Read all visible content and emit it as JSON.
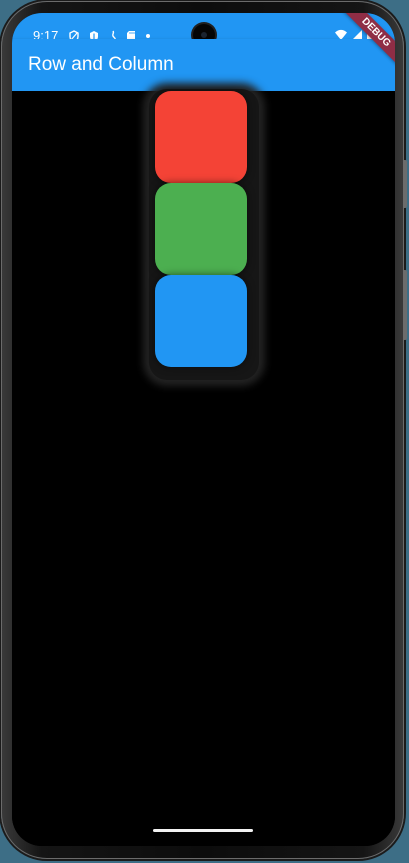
{
  "status_bar": {
    "time": "9:17",
    "background": "#2196f3",
    "left_icons": [
      "privacy-shield-icon",
      "security-shield-icon",
      "assistant-icon",
      "sd-card-icon",
      "notification-dot-icon"
    ],
    "right_icons": [
      "wifi-icon",
      "signal-icon",
      "battery-icon"
    ]
  },
  "app_bar": {
    "title": "Row and Column",
    "background": "#2196f3"
  },
  "debug_banner": {
    "label": "DEBUG",
    "color": "#8f2d45"
  },
  "content": {
    "background": "#000000",
    "boxes": [
      {
        "name": "red",
        "color": "#f44336"
      },
      {
        "name": "green",
        "color": "#4caf50"
      },
      {
        "name": "blue",
        "color": "#2196f3"
      }
    ]
  }
}
